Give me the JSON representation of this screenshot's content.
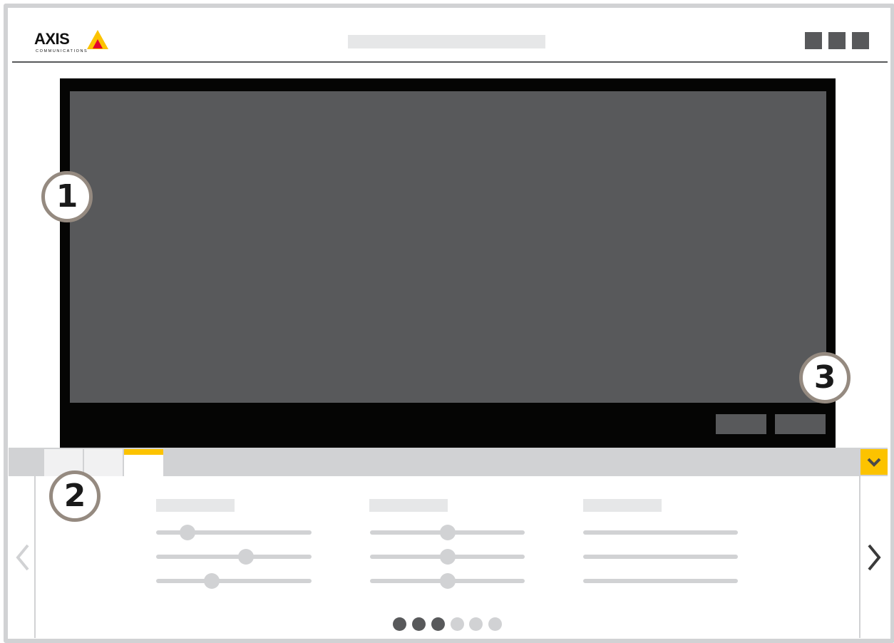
{
  "header": {
    "brand_name": "AXIS",
    "brand_sub": "COMMUNICATIONS",
    "registered_mark": "®",
    "title": "",
    "buttons": [
      "header-button-1",
      "header-button-2",
      "header-button-3"
    ]
  },
  "callouts": {
    "one": "1",
    "two": "2",
    "three": "3"
  },
  "video": {
    "controls": [
      "control-button-1",
      "control-button-2"
    ]
  },
  "tabs": {
    "count": 3,
    "active_index": 2
  },
  "settings": {
    "columns": [
      {
        "header": "",
        "sliders": [
          0.2,
          0.58,
          0.36
        ]
      },
      {
        "header": "",
        "sliders": [
          0.5,
          0.5,
          0.5
        ]
      },
      {
        "header": "",
        "sliders": []
      }
    ]
  },
  "pagination": {
    "total": 6,
    "filled": 3
  },
  "icons": {
    "collapse": "chevron-down-icon",
    "prev": "chevron-left-icon",
    "next": "chevron-right-icon"
  },
  "colors": {
    "accent": "#fcc300",
    "brand_red": "#e4032e",
    "dark": "#58595b",
    "video_bg": "#050504",
    "light": "#d1d2d4",
    "callout_ring": "#958a80"
  }
}
